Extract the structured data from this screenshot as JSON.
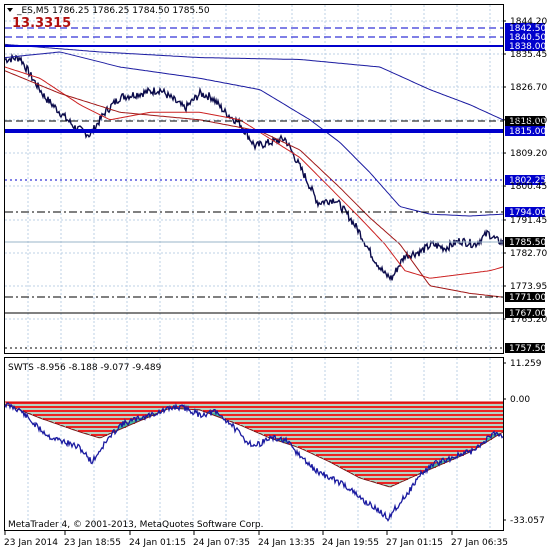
{
  "header": {
    "symbol_info": "_ES,M5  1786.25 1786.25 1784.50 1785.50",
    "spread_value": "13.3315"
  },
  "copyright": "MetaTrader 4, © 2001-2013, MetaQuotes Software Corp.",
  "colors": {
    "price": "#0a0a4a",
    "ma_fast": "#cc2222",
    "ma_slow": "#1a1aa0",
    "hline": "#0000cc",
    "tag_bg": "#0000cc",
    "tag_dark": "#000000",
    "grid": "#bcd0e6",
    "osc_red": "#ee2222",
    "osc_green": "#3cb8a8",
    "osc_line": "#1a1aa0"
  },
  "main_panel": {
    "price_axis_labels": [
      "1844.20",
      "1835.45",
      "1826.70",
      "1818.00",
      "1809.20",
      "1800.45",
      "1791.45",
      "1782.70",
      "1773.95",
      "1765.20"
    ],
    "hlines": [
      {
        "price": 1842.5,
        "style": "dash",
        "tag": "1842.50",
        "tag_color": "blue"
      },
      {
        "price": 1840.5,
        "style": "dash",
        "tag": "1840.50",
        "tag_color": "blue"
      },
      {
        "price": 1838.0,
        "style": "solid-thick",
        "tag": "1838.00",
        "tag_color": "blue"
      },
      {
        "price": 1818.0,
        "style": "dash",
        "tag": "1818.00",
        "tag_color": "dark"
      },
      {
        "price": 1815.0,
        "style": "solid-heavy",
        "tag": "1815.00",
        "tag_color": "blue"
      },
      {
        "price": 1802.25,
        "style": "dot",
        "tag": "1802.25",
        "tag_color": "blue"
      },
      {
        "price": 1794.0,
        "style": "dashdot",
        "tag": "1794.00",
        "tag_color": "blue"
      },
      {
        "price": 1785.5,
        "style": "thin-current",
        "tag": "1785.50",
        "tag_color": "dark"
      },
      {
        "price": 1771.0,
        "style": "dashdot",
        "tag": "1771.00",
        "tag_color": "dark"
      },
      {
        "price": 1767.0,
        "style": "solid",
        "tag": "1767.00",
        "tag_color": "dark"
      },
      {
        "price": 1757.5,
        "style": "dot",
        "tag": "1757.50",
        "tag_color": "dark"
      }
    ]
  },
  "sub_panel": {
    "indicator_label": "SWTS -8.956 -8.188 -9.077 -9.489",
    "axis_labels": [
      "11.259",
      "0.00",
      "-33.057"
    ]
  },
  "time_axis": [
    "23 Jan 2014",
    "23 Jan 18:55",
    "24 Jan 01:15",
    "24 Jan 07:35",
    "24 Jan 13:35",
    "24 Jan 19:55",
    "27 Jan 01:15",
    "27 Jan 06:35"
  ]
}
